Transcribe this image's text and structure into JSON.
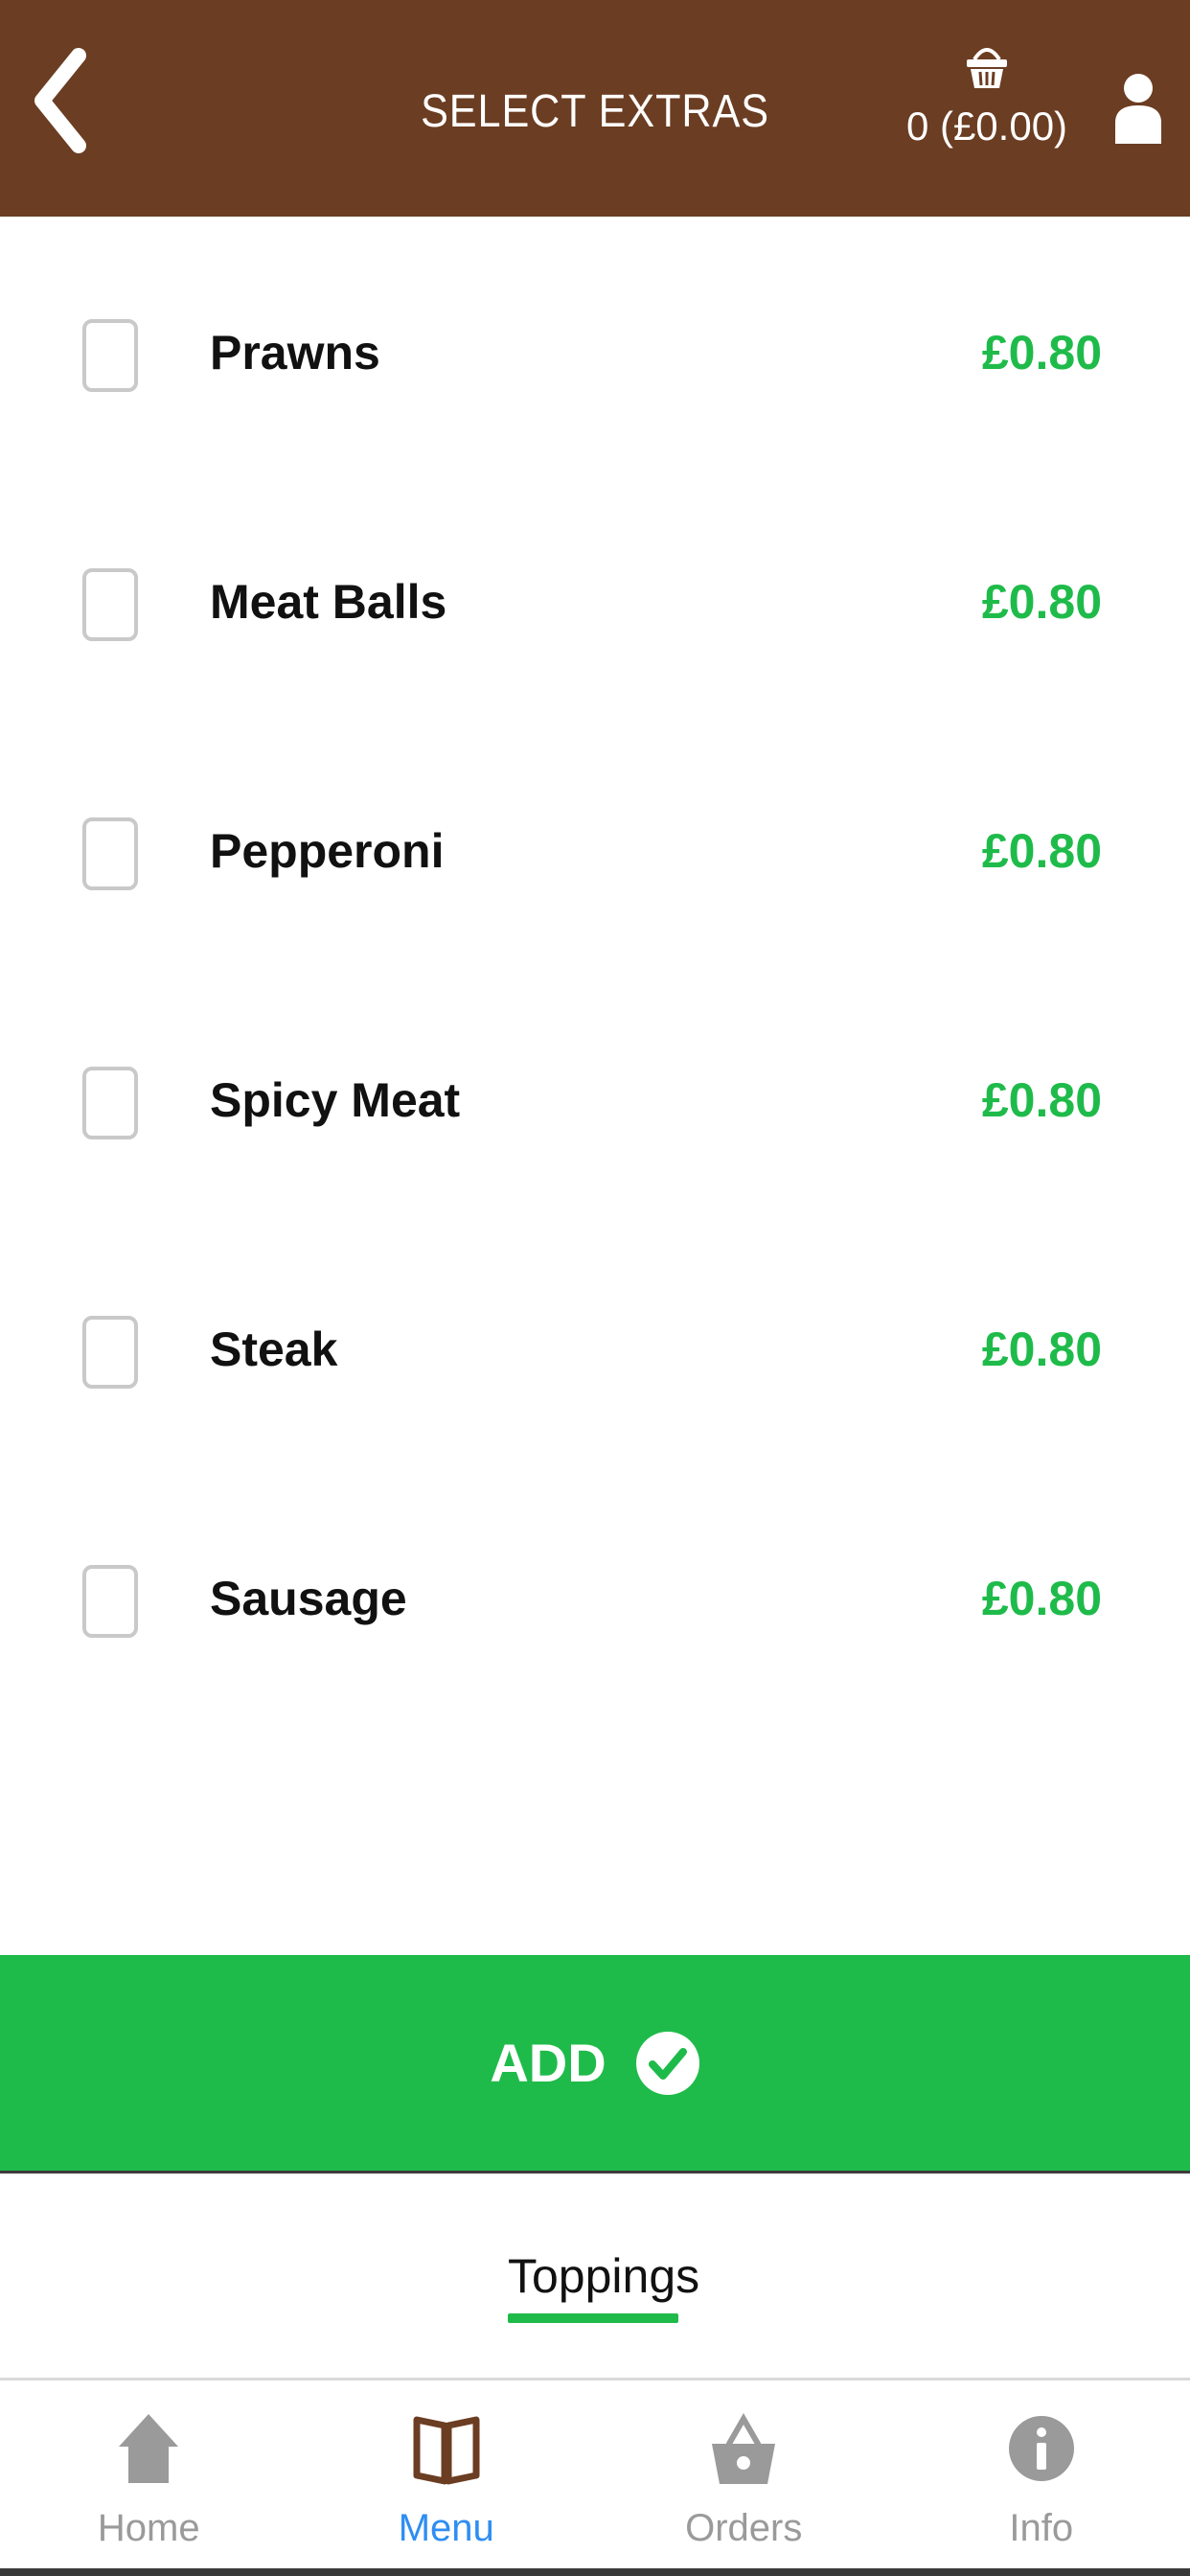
{
  "header": {
    "title": "SELECT EXTRAS",
    "basket_count": "0 (£0.00)"
  },
  "extras": [
    {
      "name": "Prawns",
      "price": "£0.80",
      "checked": false
    },
    {
      "name": "Meat Balls",
      "price": "£0.80",
      "checked": false
    },
    {
      "name": "Pepperoni",
      "price": "£0.80",
      "checked": false
    },
    {
      "name": "Spicy Meat",
      "price": "£0.80",
      "checked": false
    },
    {
      "name": "Steak",
      "price": "£0.80",
      "checked": false
    },
    {
      "name": "Sausage",
      "price": "£0.80",
      "checked": false
    }
  ],
  "add_button": {
    "label": "ADD"
  },
  "tabs": {
    "active": "Toppings"
  },
  "bottom_nav": [
    {
      "label": "Home",
      "icon": "home-icon",
      "active": false
    },
    {
      "label": "Menu",
      "icon": "book-icon",
      "active": true
    },
    {
      "label": "Orders",
      "icon": "basket-icon",
      "active": false
    },
    {
      "label": "Info",
      "icon": "info-icon",
      "active": false
    }
  ],
  "colors": {
    "header_bg": "#6b3d22",
    "accent_green": "#1fbb4a",
    "active_blue": "#2e8ef2",
    "inactive_gray": "#9a9a9a"
  }
}
